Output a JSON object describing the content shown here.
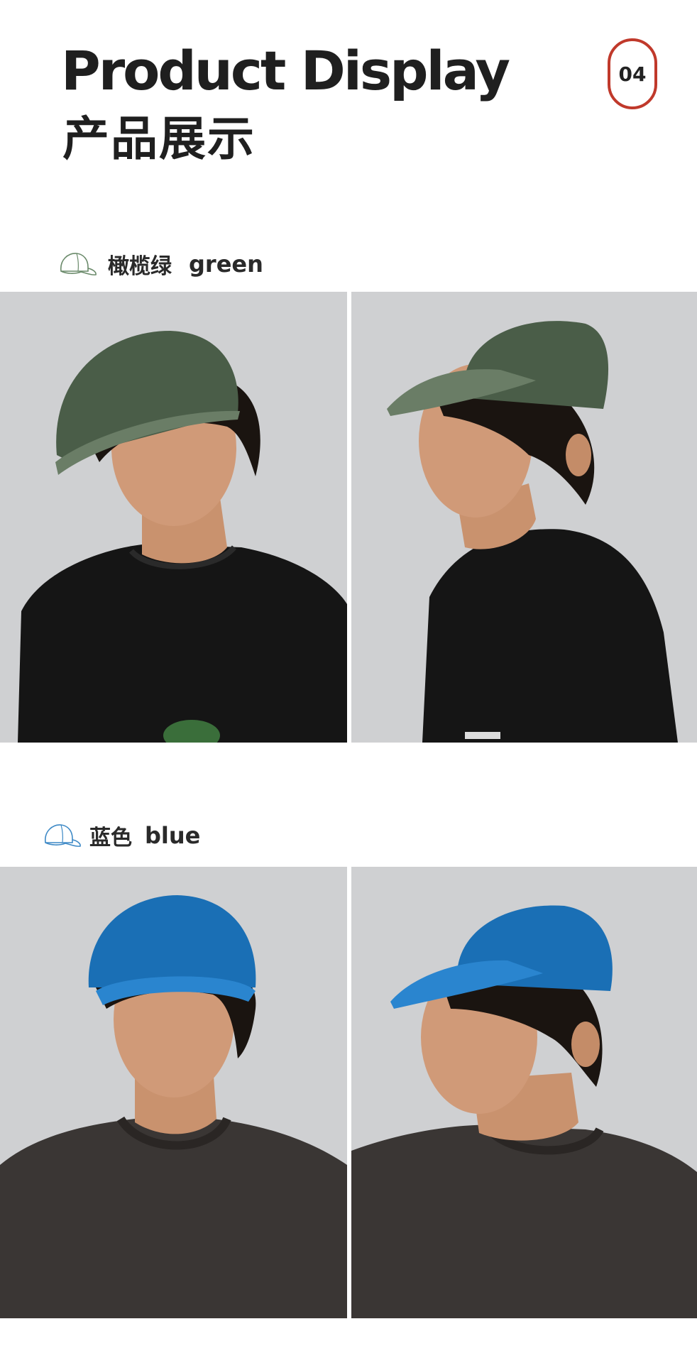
{
  "header": {
    "title_en": "Product Display",
    "title_cn": "产品展示",
    "page_number": "04"
  },
  "colors": [
    {
      "name_cn": "橄榄",
      "name_cn2": "绿",
      "name_en": "green",
      "icon": "cap-outline-icon",
      "cap_color": "#4a5d48",
      "shirt_color": "#151515"
    },
    {
      "name_cn": "蓝色",
      "name_en": "blue",
      "icon": "cap-outline-icon",
      "cap_color": "#1a6fb5",
      "shirt_color": "#3a3634"
    }
  ],
  "theme": {
    "accent": "#c0392b",
    "photo_bg": "#cfd0d2"
  }
}
